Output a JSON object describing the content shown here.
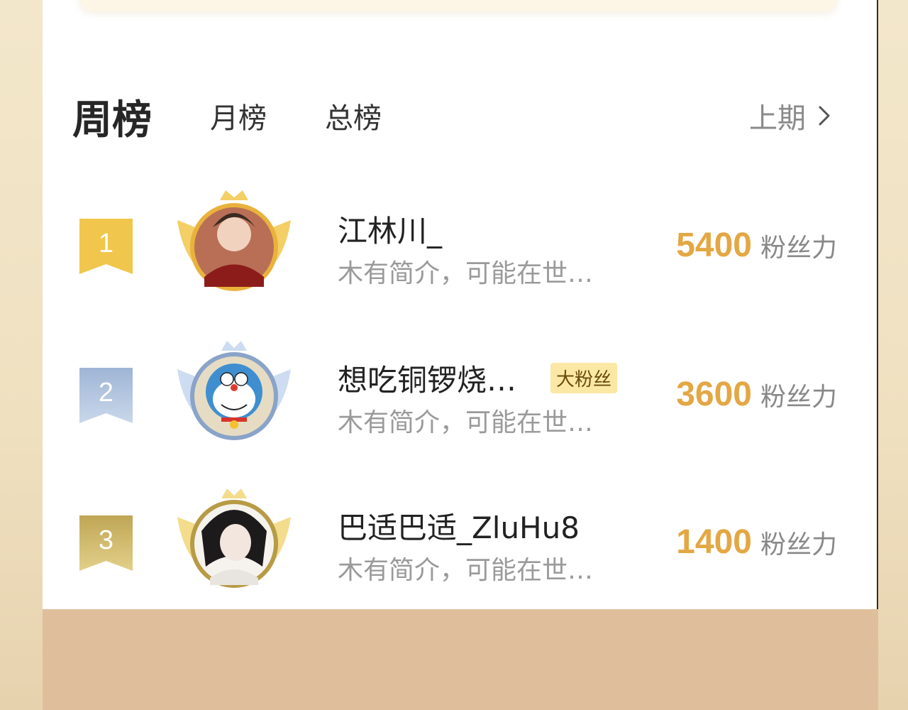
{
  "tabs": {
    "active": "周榜",
    "month": "月榜",
    "total": "总榜",
    "previous": "上期"
  },
  "colors": {
    "accent": "#e3a744",
    "gold": "#f0c64c",
    "silver": "#a9bddb",
    "bronze": "#c9b263",
    "badge_bg": "#fbe8a4"
  },
  "rankings": [
    {
      "rank": "1",
      "name": "江林川_",
      "bio": "木有简介，可能在世…",
      "badge": "",
      "score": "5400",
      "unit": "粉丝力"
    },
    {
      "rank": "2",
      "name": "想吃铜锣烧…",
      "bio": "木有简介，可能在世…",
      "badge": "大粉丝",
      "score": "3600",
      "unit": "粉丝力"
    },
    {
      "rank": "3",
      "name": "巴适巴适_ZluHu8",
      "bio": "木有简介，可能在世…",
      "badge": "",
      "score": "1400",
      "unit": "粉丝力"
    }
  ],
  "icons": {
    "chevron": "chevron-right-icon",
    "rank_flag": "rank-ribbon-icon",
    "crown": "crown-icon",
    "wings": "laurel-wings-icon"
  }
}
